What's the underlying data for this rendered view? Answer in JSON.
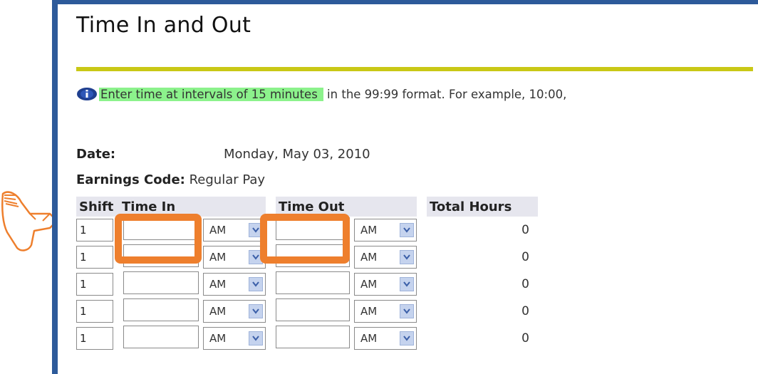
{
  "page": {
    "title": "Time In and Out",
    "info_highlight": "Enter time at intervals of 15 minutes",
    "info_rest": " in the 99:99 format. For example, 10:00,"
  },
  "fields": {
    "date_label": "Date:",
    "date_value": "Monday, May 03, 2010",
    "earnings_label": "Earnings Code:",
    "earnings_value": "Regular Pay"
  },
  "table": {
    "headers": {
      "shift": "Shift",
      "time_in": "Time In",
      "time_out": "Time Out",
      "total_hours": "Total Hours"
    },
    "rows": [
      {
        "shift": "1",
        "time_in": "",
        "in_ampm": "AM",
        "time_out": "",
        "out_ampm": "AM",
        "total": "0"
      },
      {
        "shift": "1",
        "time_in": "",
        "in_ampm": "AM",
        "time_out": "",
        "out_ampm": "AM",
        "total": "0"
      },
      {
        "shift": "1",
        "time_in": "",
        "in_ampm": "AM",
        "time_out": "",
        "out_ampm": "AM",
        "total": "0"
      },
      {
        "shift": "1",
        "time_in": "",
        "in_ampm": "AM",
        "time_out": "",
        "out_ampm": "AM",
        "total": "0"
      },
      {
        "shift": "1",
        "time_in": "",
        "in_ampm": "AM",
        "time_out": "",
        "out_ampm": "AM",
        "total": "0"
      }
    ]
  },
  "colors": {
    "frame": "#2d5a9a",
    "rule": "#c9c816",
    "highlight_text_bg": "#8cf28c",
    "callout_box": "#ee7f2d",
    "pointer": "#ee7f2d"
  },
  "icons": {
    "info": "info-icon",
    "pointer": "hand-pointer-icon",
    "dropdown": "chevron-down-icon"
  }
}
